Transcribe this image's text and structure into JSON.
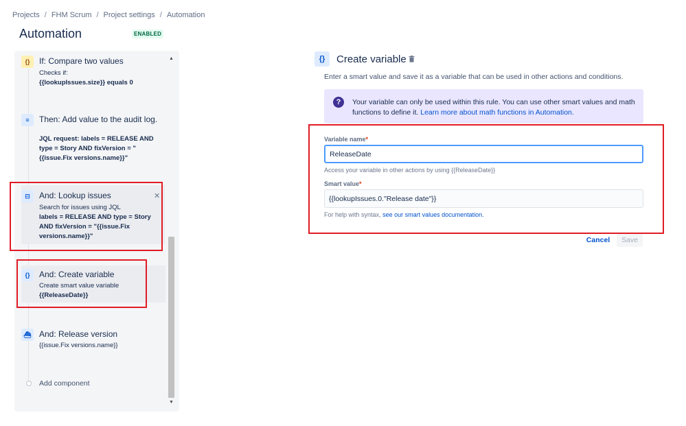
{
  "breadcrumb": [
    "Projects",
    "FHM Scrum",
    "Project settings",
    "Automation"
  ],
  "page": {
    "title": "Automation",
    "badge": "ENABLED"
  },
  "steps": [
    {
      "icon": "{}",
      "title": "If: Compare two values",
      "line1": "Checks if:",
      "line2": "{{lookupIssues.size}} equals 0"
    },
    {
      "icon": "≡",
      "title": "Then: Add value to the audit log.",
      "line1": "JQL request: labels = RELEASE AND type = Story AND fixVersion = \"{{issue.Fix versions.name}}\""
    },
    {
      "icon": "⊟",
      "title": "And: Lookup issues",
      "line1": "Search for issues using JQL",
      "line2": "labels = RELEASE AND type = Story AND fixVersion = \"{{issue.Fix versions.name}}\""
    },
    {
      "icon": "{}",
      "title": "And: Create variable",
      "line1": "Create smart value variable",
      "line2": "{{ReleaseDate}}"
    },
    {
      "icon": "⛴",
      "title": "And: Release version",
      "line1": "{{issue.Fix versions.name}}"
    }
  ],
  "add_component": "Add component",
  "editor": {
    "icon": "{}",
    "title": "Create variable",
    "description": "Enter a smart value and save it as a variable that can be used in other actions and conditions.",
    "info_text": "Your variable can only be used within this rule. You can use other smart values and math functions to define it.",
    "info_link": "Learn more about math functions in Automation.",
    "variable_name_label": "Variable name",
    "variable_name_value": "ReleaseDate",
    "variable_name_help": "Access your variable in other actions by using {{ReleaseDate}}",
    "smart_value_label": "Smart value",
    "smart_value_value": "{{lookupIssues.0.\"Release date\"}}",
    "smart_value_help": "For help with syntax,",
    "smart_value_help_link": "see our smart values documentation.",
    "required_mark": "*",
    "cancel_label": "Cancel",
    "save_label": "Save"
  },
  "colors": {
    "accent": "#0052cc",
    "highlight": "#e01b24",
    "info_bg": "#eae6ff",
    "badge_bg": "#e3fcef"
  }
}
